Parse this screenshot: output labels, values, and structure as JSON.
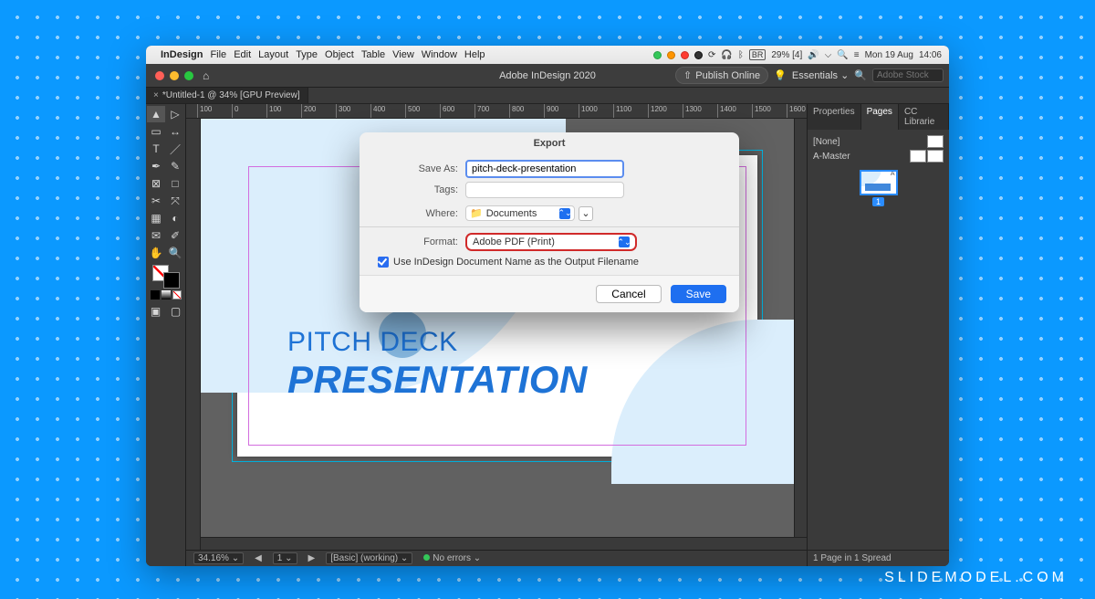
{
  "mac_menubar": {
    "app": "InDesign",
    "items": [
      "File",
      "Edit",
      "Layout",
      "Type",
      "Object",
      "Table",
      "View",
      "Window",
      "Help"
    ],
    "status_right": {
      "battery_pct": "29% [4]",
      "keyboard_layout": "BR",
      "day": "Mon 19 Aug",
      "time": "14:06"
    }
  },
  "app_bar": {
    "title": "Adobe InDesign 2020",
    "publish_btn": "Publish Online",
    "workspace": "Essentials",
    "search_placeholder": "Adobe Stock"
  },
  "doc_tab": {
    "label": "*Untitled-1 @ 34% [GPU Preview]"
  },
  "ruler_ticks": [
    "100",
    "0",
    "100",
    "200",
    "300",
    "400",
    "500",
    "600",
    "700",
    "800",
    "900",
    "1000",
    "1100",
    "1200",
    "1300",
    "1400",
    "1500",
    "1600"
  ],
  "canvas_text": {
    "line1": "PITCH DECK",
    "line2": "PRESENTATION"
  },
  "status_bar": {
    "zoom": "34.16%",
    "layer": "[Basic] (working)",
    "errors": "No errors"
  },
  "panels": {
    "tabs": [
      "Properties",
      "Pages",
      "CC Librarie"
    ],
    "active_tab": 1,
    "rows": {
      "none": "[None]",
      "master": "A-Master"
    },
    "page_number": "1",
    "footer": "1 Page in 1 Spread"
  },
  "dialog": {
    "title": "Export",
    "save_as_label": "Save As:",
    "save_as_value": "pitch-deck-presentation",
    "tags_label": "Tags:",
    "where_label": "Where:",
    "where_value": "Documents",
    "format_label": "Format:",
    "format_value": "Adobe PDF (Print)",
    "checkbox_label": "Use InDesign Document Name as the Output Filename",
    "cancel": "Cancel",
    "save": "Save"
  },
  "watermark": "SLIDEMODEL.COM"
}
